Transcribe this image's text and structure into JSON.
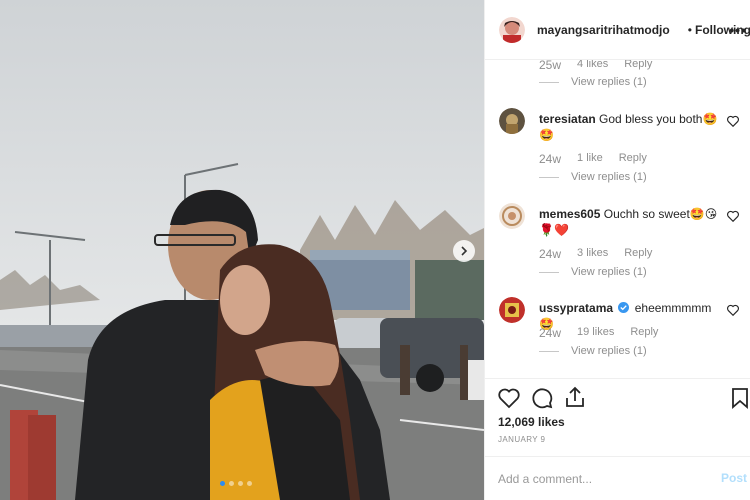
{
  "post": {
    "username": "mayangsaritrihatmodjo",
    "separator": "•",
    "follow_status": "Following",
    "more_glyph": "•••",
    "likes": "12,069 likes",
    "date": "JANUARY 9",
    "add_comment_placeholder": "Add a comment...",
    "post_label": "Post",
    "carousel": {
      "total": 4,
      "active": 1
    }
  },
  "top_partial": {
    "ago": "25w",
    "likes": "4 likes",
    "reply": "Reply",
    "view_replies": "View replies (1)"
  },
  "comments": [
    {
      "user": "teresiatan",
      "text": "God bless you both🤩🤩",
      "ago": "24w",
      "likes": "1 like",
      "reply": "Reply",
      "view_replies": "View replies (1)"
    },
    {
      "user": "memes605",
      "text": "Ouchh so sweet🤩😘🌹❤️",
      "ago": "24w",
      "likes": "3 likes",
      "reply": "Reply",
      "view_replies": "View replies (1)"
    },
    {
      "user": "ussypratama",
      "verified": true,
      "text": "eheemmmmm🤩",
      "ago": "24w",
      "likes": "19 likes",
      "reply": "Reply",
      "view_replies": "View replies (1)"
    }
  ],
  "icons": [
    "chevron-right-icon",
    "heart-icon",
    "comment-icon",
    "share-icon",
    "bookmark-icon",
    "verified-badge-icon"
  ],
  "colors": {
    "accent": "#2d8cf0",
    "text": "#262626",
    "muted": "#8e8e8e",
    "border": "#efefef",
    "post_disabled": "#b2dffc"
  }
}
